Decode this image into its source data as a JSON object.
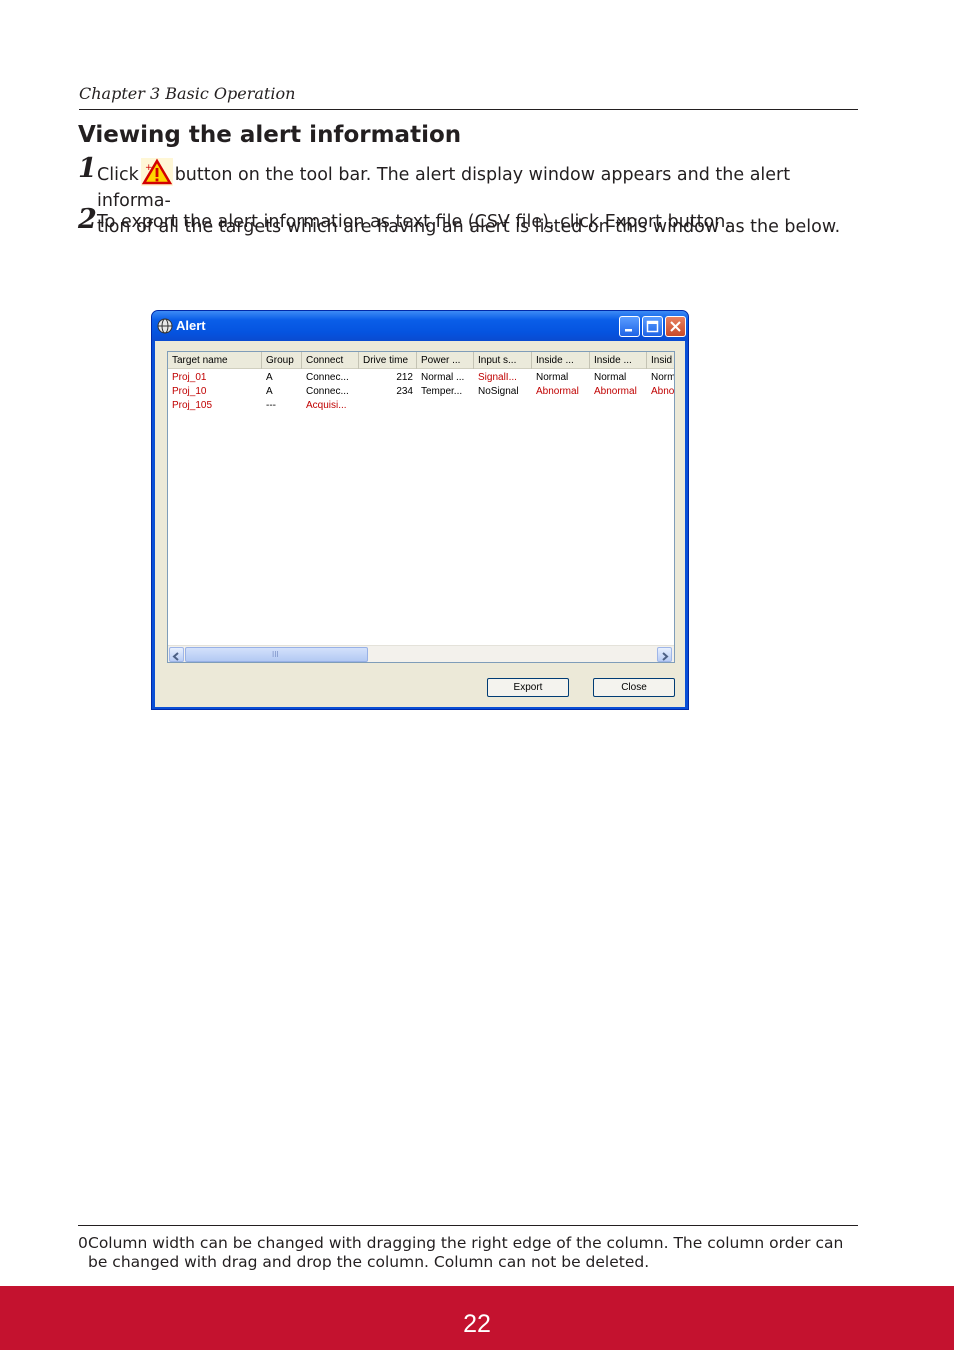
{
  "header": {
    "chapter": "Chapter 3 Basic Operation"
  },
  "section": {
    "title": "Viewing the alert information"
  },
  "steps": [
    {
      "num": "1",
      "text_before": "Click",
      "text_after": "button on the tool bar. The alert display window appears and the alert informa-",
      "text_line2": "tion of all the targets which are having an alert is listed on this window as the below.",
      "icon": "alert-warning-icon"
    },
    {
      "num": "2",
      "text_before": "To export the alert information as text file (CSV file), click",
      "emphasis": "Export",
      "text_after": "button."
    }
  ],
  "alert_window": {
    "title": "Alert",
    "icons": {
      "title": "globe-icon",
      "minimize": "minimize-icon",
      "maximize": "maximize-icon",
      "close": "close-icon"
    },
    "columns": [
      "Target name",
      "Group",
      "Connect",
      "Drive time",
      "Power ...",
      "Input s...",
      "Inside ...",
      "Inside ...",
      "Insid"
    ],
    "rows": [
      [
        "Proj_01",
        "A",
        "Connec...",
        "212",
        "Normal ...",
        "SignalI...",
        "Normal",
        "Normal",
        "Norm"
      ],
      [
        "Proj_10",
        "A",
        "Connec...",
        "234",
        "Temper...",
        "NoSignal",
        "Abnormal",
        "Abnormal",
        "Abno"
      ],
      [
        "Proj_105",
        "---",
        "Acquisi...",
        "",
        "",
        "",
        "",
        "",
        ""
      ]
    ],
    "scrollbar_grip": "III",
    "buttons": {
      "export": "Export",
      "close": "Close"
    },
    "colors": {
      "alert_text": "#c00000",
      "titlebar": "#0554e0"
    }
  },
  "footnote": {
    "mark": "0",
    "text": "Column width can be changed with dragging the right edge of the column. The column order can be changed with drag and drop the column. Column can not be deleted."
  },
  "footer": {
    "page_number": "22",
    "color": "#c4122f"
  }
}
